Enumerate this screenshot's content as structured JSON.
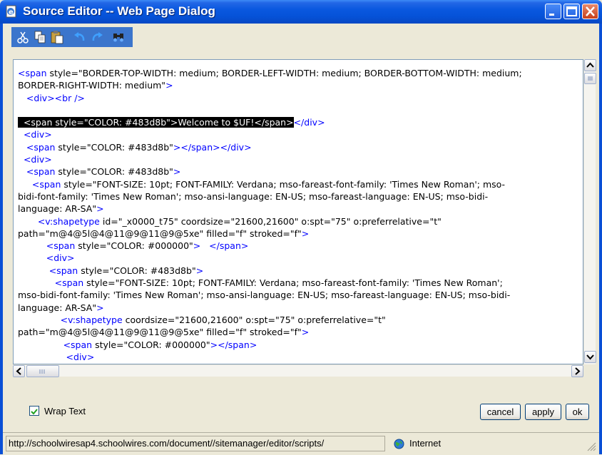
{
  "window": {
    "title": "Source Editor -- Web Page Dialog"
  },
  "toolbar": {
    "tools": [
      "cut-icon",
      "copy-icon",
      "paste-icon",
      "undo-icon",
      "redo-icon",
      "find-icon"
    ]
  },
  "editor": {
    "lines": [
      [
        {
          "t": "<span ",
          "c": "tag"
        },
        {
          "t": "style=\"BORDER-TOP-WIDTH: medium; BORDER-LEFT-WIDTH: medium; BORDER-BOTTOM-WIDTH: medium;"
        }
      ],
      [
        {
          "t": "BORDER-RIGHT-WIDTH: medium\""
        },
        {
          "t": ">",
          "c": "tag"
        }
      ],
      [
        {
          "t": "   <div><br />",
          "c": "tag"
        }
      ],
      [
        {
          "t": ""
        }
      ],
      [
        {
          "t": "  <span style=\"COLOR: #483d8b\">Welcome to $UF!</span>",
          "c": "sel"
        },
        {
          "t": "</div>",
          "c": "tag"
        }
      ],
      [
        {
          "t": "  <div>",
          "c": "tag"
        }
      ],
      [
        {
          "t": "   <span ",
          "c": "tag"
        },
        {
          "t": "style=\"COLOR: #483d8b\""
        },
        {
          "t": "></span></div>",
          "c": "tag"
        }
      ],
      [
        {
          "t": "  <div>",
          "c": "tag"
        }
      ],
      [
        {
          "t": "   <span ",
          "c": "tag"
        },
        {
          "t": "style=\"COLOR: #483d8b\""
        },
        {
          "t": ">",
          "c": "tag"
        }
      ],
      [
        {
          "t": "     <span ",
          "c": "tag"
        },
        {
          "t": "style=\"FONT-SIZE: 10pt; FONT-FAMILY: Verdana; mso-fareast-font-family: 'Times New Roman'; mso-"
        }
      ],
      [
        {
          "t": "bidi-font-family: 'Times New Roman'; mso-ansi-language: EN-US; mso-fareast-language: EN-US; mso-bidi-"
        }
      ],
      [
        {
          "t": "language: AR-SA\""
        },
        {
          "t": ">",
          "c": "tag"
        }
      ],
      [
        {
          "t": "       <v:shapetype ",
          "c": "tag"
        },
        {
          "t": "id=\"_x0000_t75\" coordsize=\"21600,21600\" o:spt=\"75\" o:preferrelative=\"t\""
        }
      ],
      [
        {
          "t": "path=\"m@4@5l@4@11@9@11@9@5xe\" filled=\"f\" stroked=\"f\""
        },
        {
          "t": ">",
          "c": "tag"
        }
      ],
      [
        {
          "t": "          <span ",
          "c": "tag"
        },
        {
          "t": "style=\"COLOR: #000000\""
        },
        {
          "t": ">   </span>",
          "c": "tag"
        }
      ],
      [
        {
          "t": "          <div>",
          "c": "tag"
        }
      ],
      [
        {
          "t": "           <span ",
          "c": "tag"
        },
        {
          "t": "style=\"COLOR: #483d8b\""
        },
        {
          "t": ">",
          "c": "tag"
        }
      ],
      [
        {
          "t": "             <span ",
          "c": "tag"
        },
        {
          "t": "style=\"FONT-SIZE: 10pt; FONT-FAMILY: Verdana; mso-fareast-font-family: 'Times New Roman';"
        }
      ],
      [
        {
          "t": "mso-bidi-font-family: 'Times New Roman'; mso-ansi-language: EN-US; mso-fareast-language: EN-US; mso-bidi-"
        }
      ],
      [
        {
          "t": "language: AR-SA\""
        },
        {
          "t": ">",
          "c": "tag"
        }
      ],
      [
        {
          "t": "               <v:shapetype ",
          "c": "tag"
        },
        {
          "t": "coordsize=\"21600,21600\" o:spt=\"75\" o:preferrelative=\"t\""
        }
      ],
      [
        {
          "t": "path=\"m@4@5l@4@11@9@11@9@5xe\" filled=\"f\" stroked=\"f\""
        },
        {
          "t": ">",
          "c": "tag"
        }
      ],
      [
        {
          "t": "                <span ",
          "c": "tag"
        },
        {
          "t": "style=\"COLOR: #000000\""
        },
        {
          "t": "></span>",
          "c": "tag"
        }
      ],
      [
        {
          "t": "                 <div>",
          "c": "tag"
        }
      ]
    ]
  },
  "options": {
    "wrap_text_label": "Wrap Text",
    "wrap_text_checked": true
  },
  "buttons": {
    "cancel": "cancel",
    "apply": "apply",
    "ok": "ok"
  },
  "statusbar": {
    "url": "http://schoolwiresap4.schoolwires.com/document//sitemanager/editor/scripts/",
    "zone": "Internet"
  },
  "colors": {
    "titlebar": "#0552d8",
    "tag": "#0000ff",
    "selection": "#000000"
  }
}
